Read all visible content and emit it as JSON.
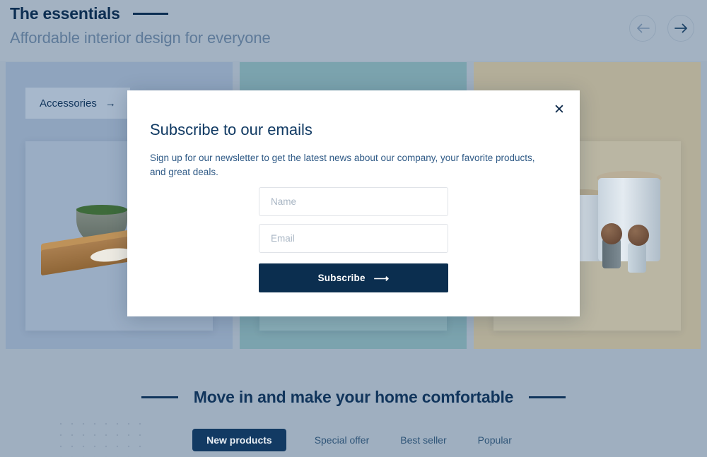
{
  "header": {
    "title": "The essentials",
    "subtitle": "Affordable interior design for everyone",
    "prev_icon": "arrow-left-icon",
    "next_icon": "arrow-right-icon"
  },
  "cards": [
    {
      "label": "Accessories",
      "arrow": "→",
      "color": "#8FA4BE"
    },
    {
      "label": "",
      "arrow": "",
      "color": "#7BA3AE"
    },
    {
      "label": "",
      "arrow": "",
      "color": "#B3AE99"
    }
  ],
  "modal": {
    "title": "Subscribe to our emails",
    "description": "Sign up for our newsletter to get the latest news about our company, your favorite products, and great deals.",
    "close_icon": "close-icon",
    "name_placeholder": "Name",
    "name_value": "",
    "email_placeholder": "Email",
    "email_value": "",
    "subscribe_label": "Subscribe",
    "subscribe_arrow": "⟶"
  },
  "bottom": {
    "heading": "Move in and make your home comfortable",
    "tabs": [
      {
        "label": "New products",
        "active": true
      },
      {
        "label": "Special offer",
        "active": false
      },
      {
        "label": "Best seller",
        "active": false
      },
      {
        "label": "Popular",
        "active": false
      }
    ]
  },
  "colors": {
    "page_background": "#9FAFC0",
    "header_background": "#A3B2C2",
    "navy": "#0C2E52",
    "muted_blue": "#5E7A99",
    "button_navy": "#0B2E4F",
    "tab_active": "#123A63"
  }
}
